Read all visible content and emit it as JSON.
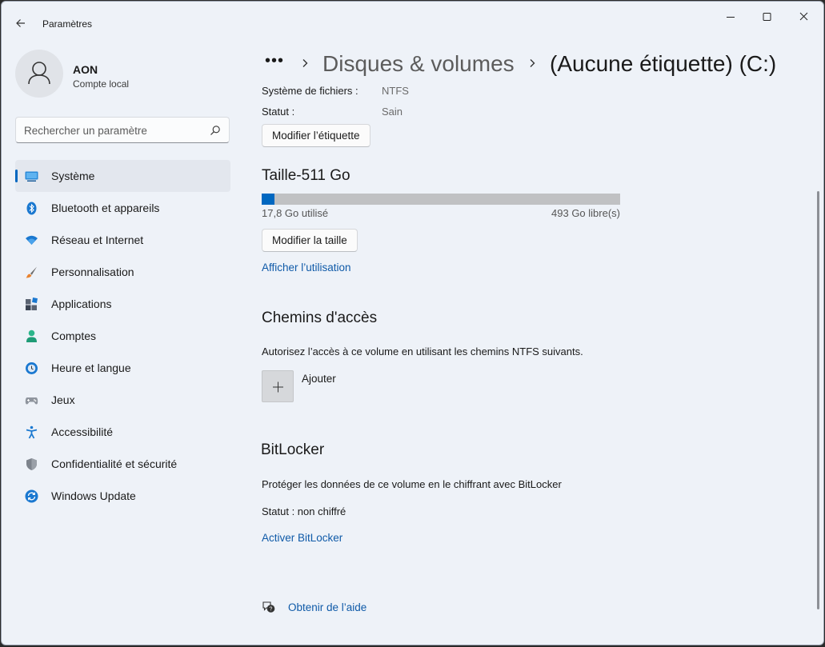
{
  "window": {
    "app_title": "Paramètres"
  },
  "profile": {
    "name": "AON",
    "account_type": "Compte local"
  },
  "search": {
    "placeholder": "Rechercher un paramètre"
  },
  "sidebar": {
    "items": [
      {
        "label": "Système",
        "icon": "system-icon",
        "active": true
      },
      {
        "label": "Bluetooth et appareils",
        "icon": "bluetooth-icon",
        "active": false
      },
      {
        "label": "Réseau et Internet",
        "icon": "wifi-icon",
        "active": false
      },
      {
        "label": "Personnalisation",
        "icon": "brush-icon",
        "active": false
      },
      {
        "label": "Applications",
        "icon": "apps-icon",
        "active": false
      },
      {
        "label": "Comptes",
        "icon": "person-icon",
        "active": false
      },
      {
        "label": "Heure et langue",
        "icon": "globe-clock-icon",
        "active": false
      },
      {
        "label": "Jeux",
        "icon": "gamepad-icon",
        "active": false
      },
      {
        "label": "Accessibilité",
        "icon": "accessibility-icon",
        "active": false
      },
      {
        "label": "Confidentialité et sécurité",
        "icon": "shield-icon",
        "active": false
      },
      {
        "label": "Windows Update",
        "icon": "update-icon",
        "active": false
      }
    ]
  },
  "header": {
    "more": "•••",
    "crumb_parent": "Disques & volumes",
    "crumb_current": "(Aucune étiquette) (C:)"
  },
  "properties": {
    "filesystem_label": "Système de fichiers :",
    "filesystem_value": "NTFS",
    "status_label": "Statut :",
    "status_value": "Sain",
    "rename_button": "Modifier l’étiquette"
  },
  "size": {
    "title": "Taille-511 Go",
    "used": "17,8 Go utilisé",
    "free": "493 Go libre(s)",
    "used_fraction": 0.035,
    "resize_button": "Modifier la taille",
    "usage_link": "Afficher l’utilisation"
  },
  "paths": {
    "title": "Chemins d'accès",
    "description": "Autorisez l’accès à ce volume en utilisant les chemins NTFS suivants.",
    "add_label": "Ajouter"
  },
  "bitlocker": {
    "title": "BitLocker",
    "description": "Protéger les données de ce volume en le chiffrant avec BitLocker",
    "status": "Statut : non chiffré",
    "activate_link": "Activer BitLocker"
  },
  "help": {
    "label": "Obtenir de l’aide"
  },
  "colors": {
    "accent": "#0067c0",
    "link": "#0f5aa8",
    "background": "#eef2f8"
  }
}
